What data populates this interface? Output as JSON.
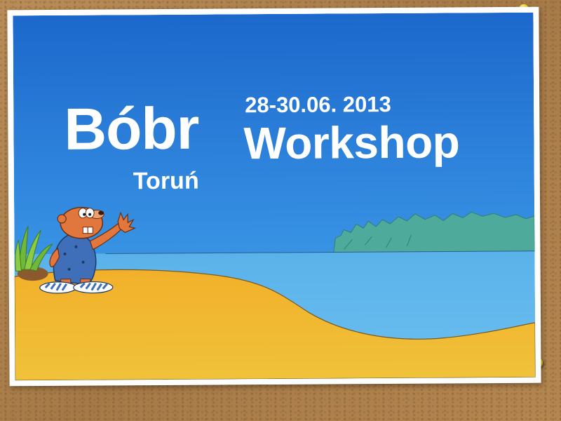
{
  "poster": {
    "title": "Bóbr",
    "date": "28-30.06. 2013",
    "subtitle": "Workshop",
    "location": "Toruń"
  },
  "colors": {
    "sky_top": "#1e6fd0",
    "sky_bottom": "#45a6ec",
    "water": "#5db3e8",
    "sand": "#efb02a",
    "trees": "#4eaa9a",
    "beaver": "#e2773e",
    "pin_red": "#d41414",
    "pin_yellow": "#e6d21a"
  },
  "icons": {
    "mascot": "beaver-mascot-icon",
    "plant": "grass-plant-icon",
    "pins": "push-pin-icon"
  }
}
